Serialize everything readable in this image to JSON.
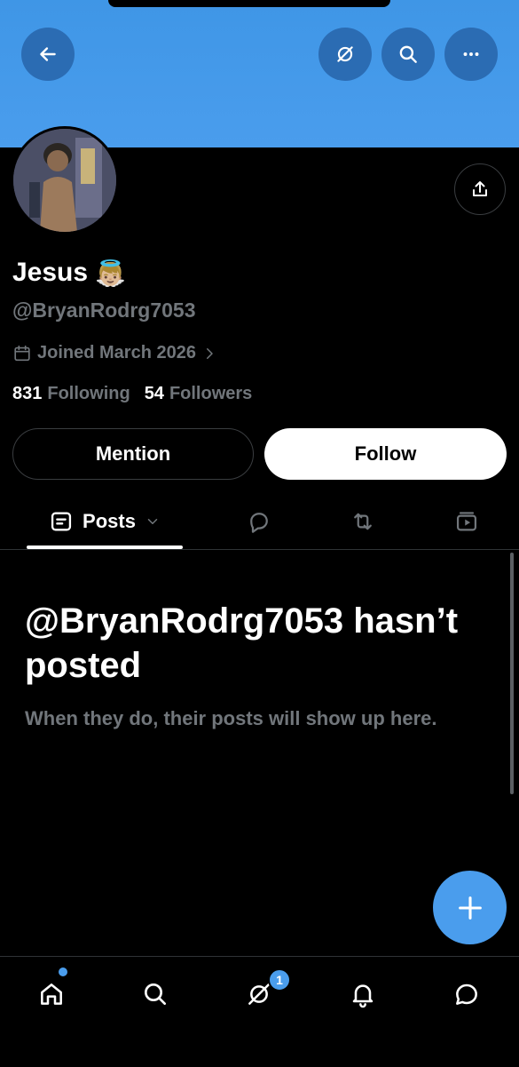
{
  "profile": {
    "name": "Jesus",
    "name_emoji": "👼🏼",
    "handle": "@BryanRodrg7053",
    "joined": "Joined March 2026",
    "following_count": "831",
    "following_label": "Following",
    "followers_count": "54",
    "followers_label": "Followers"
  },
  "actions": {
    "mention_label": "Mention",
    "follow_label": "Follow"
  },
  "tabs": {
    "posts_label": "Posts"
  },
  "empty_state": {
    "title": "@BryanRodrg7053 hasn’t posted",
    "subtitle": "When they do, their posts will show up here."
  },
  "bottom_nav": {
    "badge_count": "1"
  },
  "icons": {
    "header": [
      "back-arrow-icon",
      "grok-icon",
      "search-icon",
      "more-icon"
    ],
    "share": "share-icon",
    "tabs": [
      "posts-icon",
      "chevron-down-icon",
      "reply-icon",
      "repost-icon",
      "media-icon"
    ],
    "nav": [
      "home-icon",
      "search-icon",
      "grok-icon",
      "notifications-icon",
      "messages-icon"
    ],
    "fab": "plus-icon"
  },
  "colors": {
    "banner": "#4a9ded",
    "accent": "#4a9ded",
    "muted_text": "#71767b",
    "background": "#000000"
  }
}
